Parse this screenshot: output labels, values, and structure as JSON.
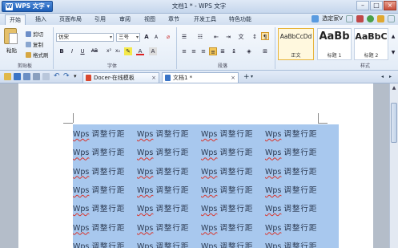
{
  "app": {
    "button_label": "WPS 文字",
    "window_title": "文档1 * - WPS 文字"
  },
  "menu": {
    "tabs": [
      "开始",
      "插入",
      "页面布局",
      "引用",
      "审阅",
      "视图",
      "章节",
      "开发工具",
      "特色功能"
    ],
    "active_tab": "开始",
    "right_label": "选定家V"
  },
  "ribbon": {
    "clipboard": {
      "paste": "粘贴",
      "cut": "剪切",
      "copy": "复制",
      "format_painter": "格式刷",
      "group": "剪贴板"
    },
    "font": {
      "family": "仿宋",
      "size": "三号",
      "bold": "B",
      "italic": "I",
      "underline": "U",
      "group": "字体"
    },
    "paragraph": {
      "group": "段落"
    },
    "styles": {
      "items": [
        {
          "sample": "AaBbCcDd",
          "name": "正文"
        },
        {
          "sample": "AaBb",
          "name": "标题 1"
        },
        {
          "sample": "AaBbC",
          "name": "标题 2"
        }
      ],
      "group": "样式"
    }
  },
  "doc_tabs": [
    {
      "label": "Docer-在线模板",
      "active": false
    },
    {
      "label": "文档1 *",
      "active": true
    }
  ],
  "document": {
    "word": "Wps",
    "text": "调整行距",
    "rows": 7,
    "cols": 4
  },
  "colors": {
    "selection": "#a8c8ee",
    "accent": "#1d5fb8",
    "spell_underline": "#d9342b"
  }
}
